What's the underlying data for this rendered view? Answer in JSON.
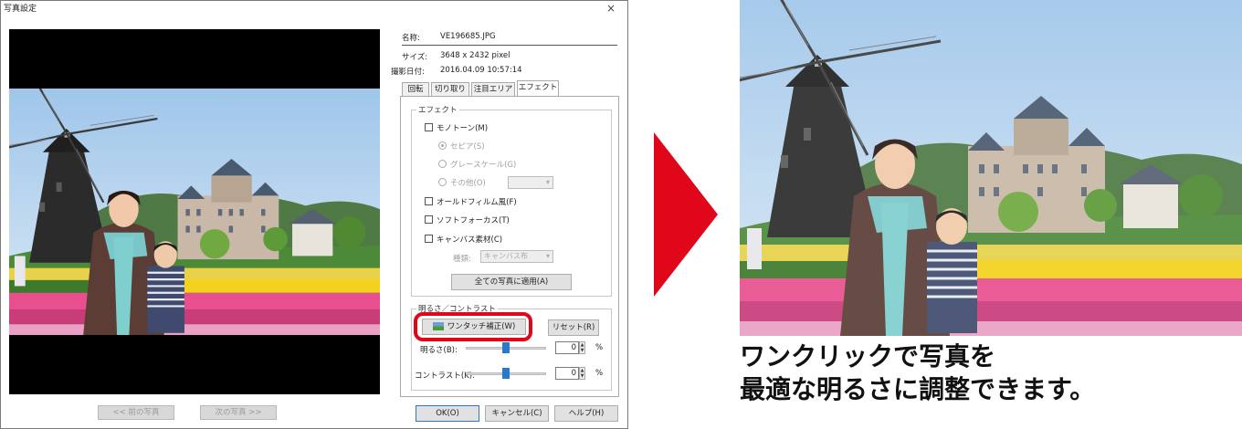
{
  "dialog": {
    "title": "写真設定",
    "close_glyph": "×",
    "prev_button": "<< 前の写真",
    "next_button": "次の写真 >>",
    "ok_button": "OK(O)",
    "cancel_button": "キャンセル(C)",
    "help_button": "ヘルプ(H)"
  },
  "info": {
    "name_label": "名称:",
    "name_value": "VE196685.JPG",
    "size_label": "サイズ:",
    "size_value": "3648 x 2432 pixel",
    "date_label": "撮影日付:",
    "date_value": "2016.04.09 10:57:14"
  },
  "tabs": [
    {
      "label": "回転"
    },
    {
      "label": "切り取り"
    },
    {
      "label": "注目エリア"
    },
    {
      "label": "エフェクト"
    }
  ],
  "effect": {
    "group_title": "エフェクト",
    "monotone": "モノトーン(M)",
    "sepia": "セピア(S)",
    "grayscale": "グレースケール(G)",
    "other": "その他(O)",
    "oldfilm": "オールドフィルム風(F)",
    "softfocus": "ソフトフォーカス(T)",
    "canvas": "キャンバス素材(C)",
    "kind_label": "種類:",
    "kind_value": "キャンバス布",
    "apply_all_button": "全ての写真に適用(A)"
  },
  "brightness": {
    "group_title": "明るさ／コントラスト",
    "onetouch_button": "ワンタッチ補正(W)",
    "reset_button": "リセット(R)",
    "brightness_label": "明るさ(B):",
    "brightness_value": "0",
    "contrast_label": "コントラスト(K):",
    "contrast_value": "0",
    "percent": "%",
    "brightness_level": 0.5,
    "contrast_level": 0.5
  },
  "caption": {
    "line1": "ワンクリックで写真を",
    "line2": "最適な明るさに調整できます。"
  },
  "colors": {
    "arrow": "#e0071a",
    "highlight_ring": "#e0071a",
    "slider_thumb": "#2a78c8"
  },
  "icons": {
    "onetouch": "landscape-photo-icon",
    "arrow": "right-triangle-arrow-icon"
  }
}
